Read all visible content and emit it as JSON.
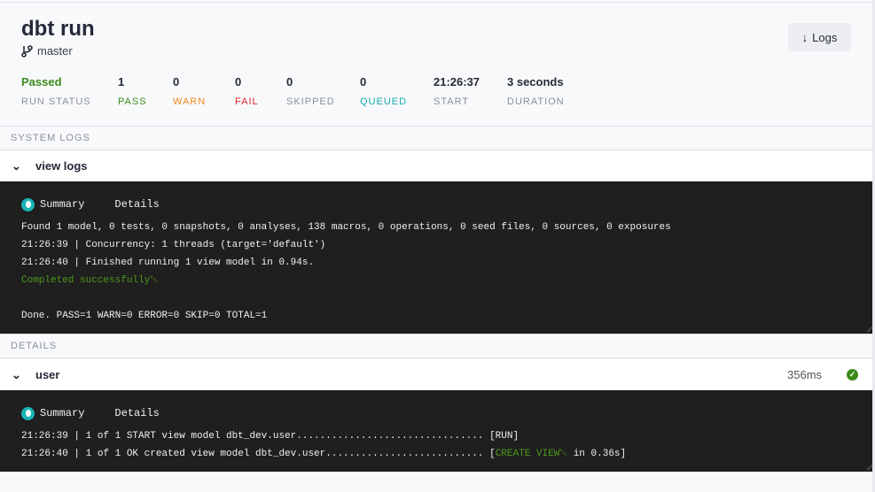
{
  "header": {
    "title": "dbt run",
    "branch": "master",
    "logs_button": "Logs"
  },
  "stats": [
    {
      "value": "Passed",
      "label": "RUN STATUS",
      "value_color": "#3b8a1a",
      "label_color": "#8a8f9b"
    },
    {
      "value": "1",
      "label": "PASS",
      "value_color": "#262a38",
      "label_color": "#3b8a1a"
    },
    {
      "value": "0",
      "label": "WARN",
      "value_color": "#262a38",
      "label_color": "#f28a1c"
    },
    {
      "value": "0",
      "label": "FAIL",
      "value_color": "#262a38",
      "label_color": "#e02424"
    },
    {
      "value": "0",
      "label": "SKIPPED",
      "value_color": "#262a38",
      "label_color": "#8a8f9b"
    },
    {
      "value": "0",
      "label": "QUEUED",
      "value_color": "#262a38",
      "label_color": "#15a9ac"
    },
    {
      "value": "21:26:37",
      "label": "START",
      "value_color": "#262a38",
      "label_color": "#8a8f9b"
    },
    {
      "value": "3 seconds",
      "label": "DURATION",
      "value_color": "#262a38",
      "label_color": "#8a8f9b"
    }
  ],
  "system_logs": {
    "section": "SYSTEM LOGS",
    "row_label": "view logs",
    "tabs": [
      "Summary",
      "Details"
    ],
    "lines": [
      "Found 1 model, 0 tests, 0 snapshots, 0 analyses, 138 macros, 0 operations, 0 seed files, 0 sources, 0 exposures",
      "21:26:39 | Concurrency: 1 threads (target='default')",
      "21:26:40 | Finished running 1 view model in 0.94s.",
      "Completed successfully␛",
      "",
      "Done. PASS=1 WARN=0 ERROR=0 SKIP=0 TOTAL=1"
    ]
  },
  "details": {
    "section": "DETAILS",
    "row_label": "user",
    "duration": "356ms",
    "tabs": [
      "Summary",
      "Details"
    ],
    "line1": "21:26:39 | 1 of 1 START view model dbt_dev.user................................ [RUN]",
    "line2_pre": "21:26:40 | 1 of 1 OK created view model dbt_dev.user........................... [",
    "line2_green": "CREATE VIEW␛",
    "line2_post": " in 0.36s]"
  }
}
